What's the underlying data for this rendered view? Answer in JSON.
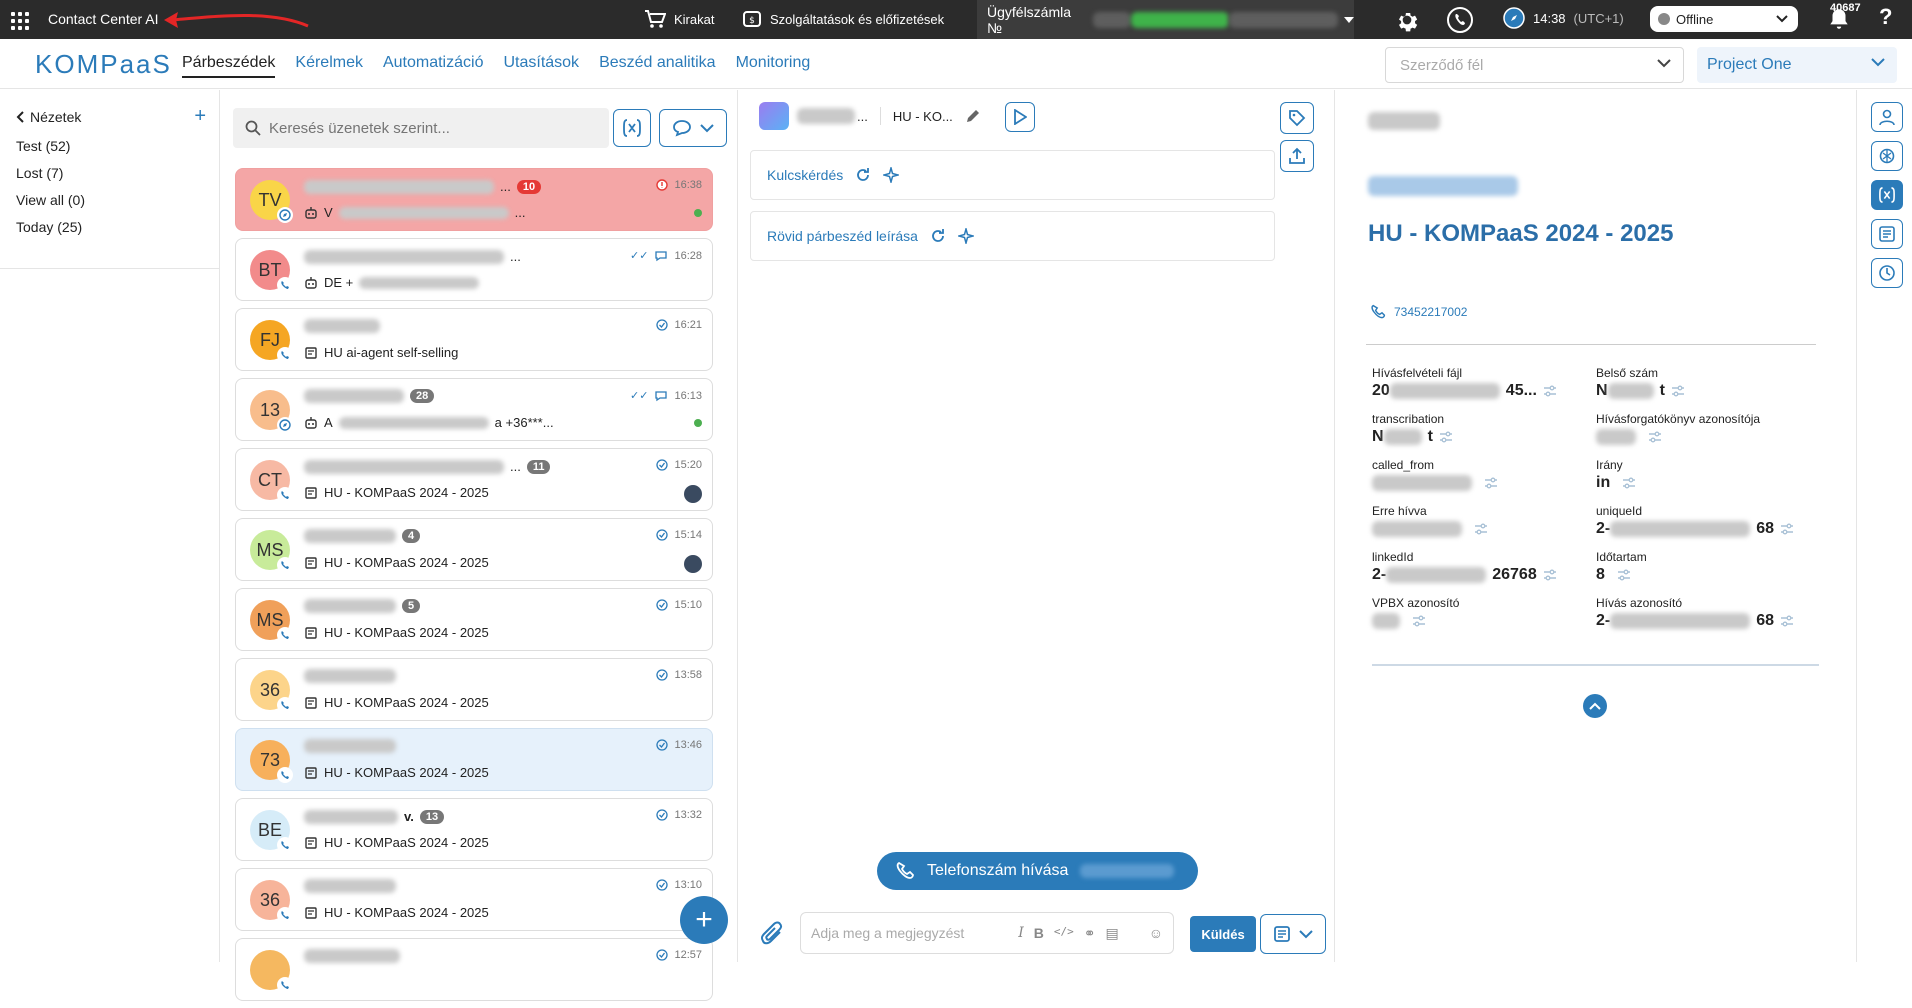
{
  "topbar": {
    "app_title": "Contact Center AI",
    "shop_label": "Kirakat",
    "services_label": "Szolgáltatások és előfizetések",
    "account_label": "Ügyfélszámla №",
    "time": "14:38",
    "timezone": "(UTC+1)",
    "status": "Offline",
    "notification_count": "40687",
    "help": "?"
  },
  "navbar": {
    "logo": "KOMPaaS",
    "tabs": [
      "Párbeszédek",
      "Kérelmek",
      "Automatizáció",
      "Utasítások",
      "Beszéd analitika",
      "Monitoring"
    ],
    "party_placeholder": "Szerződő fél",
    "project": "Project One"
  },
  "views": {
    "header": "Nézetek",
    "add": "+",
    "items": [
      "Test (52)",
      "Lost (7)",
      "View all (0)",
      "Today (25)"
    ]
  },
  "search": {
    "placeholder": "Keresés üzenetek szerint..."
  },
  "conversations": [
    {
      "initials": "TV",
      "color": "#f9d548",
      "count": "10",
      "time": "16:38",
      "sub": "V",
      "sub_suffix": "...",
      "state": "alert"
    },
    {
      "initials": "BT",
      "color": "#f28b8b",
      "count": "",
      "time": "16:28",
      "sub": "DE +",
      "sub_suffix": "",
      "state": ""
    },
    {
      "initials": "FJ",
      "color": "#f5a623",
      "count": "",
      "time": "16:21",
      "sub": "HU ai-agent self-selling",
      "sub_suffix": "",
      "state": ""
    },
    {
      "initials": "13",
      "color": "#f8bd8c",
      "count": "28",
      "time": "16:13",
      "sub": "A",
      "sub_suffix": "a +36***...",
      "state": ""
    },
    {
      "initials": "CT",
      "color": "#f7b9a4",
      "count": "11",
      "time": "15:20",
      "sub": "HU - KOMPaaS 2024 - 2025",
      "sub_suffix": "",
      "state": ""
    },
    {
      "initials": "MS",
      "color": "#c8eb9a",
      "count": "4",
      "time": "15:14",
      "sub": "HU - KOMPaaS 2024 - 2025",
      "sub_suffix": "",
      "state": ""
    },
    {
      "initials": "MS",
      "color": "#f0a05a",
      "count": "5",
      "time": "15:10",
      "sub": "HU - KOMPaaS 2024 - 2025",
      "sub_suffix": "",
      "state": ""
    },
    {
      "initials": "36",
      "color": "#fcd48a",
      "count": "",
      "time": "13:58",
      "sub": "HU - KOMPaaS 2024 - 2025",
      "sub_suffix": "",
      "state": ""
    },
    {
      "initials": "73",
      "color": "#f7b05c",
      "count": "",
      "time": "13:46",
      "sub": "HU - KOMPaaS 2024 - 2025",
      "sub_suffix": "",
      "state": "selected"
    },
    {
      "initials": "BE",
      "color": "#d6ecf8",
      "count": "13",
      "time": "13:32",
      "sub": "HU - KOMPaaS 2024 - 2025",
      "sub_suffix": "",
      "state": ""
    },
    {
      "initials": "36",
      "color": "#f7b49a",
      "count": "",
      "time": "13:10",
      "sub": "HU - KOMPaaS 2024 - 2025",
      "sub_suffix": "",
      "state": ""
    },
    {
      "initials": "",
      "color": "#f5b860",
      "count": "",
      "time": "12:57",
      "sub": "",
      "sub_suffix": "",
      "state": ""
    }
  ],
  "chat": {
    "title_suffix": "...",
    "label": "HU - KO...",
    "key_question": "Kulcskérdés",
    "short_summary": "Rövid párbeszéd leírása",
    "call_button": "Telefonszám hívása",
    "note_placeholder": "Adja meg a megjegyzést",
    "send": "Küldés"
  },
  "detail": {
    "title": "HU - KOMPaaS 2024 - 2025",
    "phone": "73452217002",
    "fields": [
      {
        "label": "Hívásfelvételi fájl",
        "value": "20",
        "suffix": "45..."
      },
      {
        "label": "Belső szám",
        "value": "N",
        "suffix": "t"
      },
      {
        "label": "transcribation",
        "value": "N",
        "suffix": "t"
      },
      {
        "label": "Hívásforgatókönyv azonosítója",
        "value": "",
        "suffix": ""
      },
      {
        "label": "called_from",
        "value": "",
        "suffix": ""
      },
      {
        "label": "Irány",
        "value": "in",
        "suffix": ""
      },
      {
        "label": "Erre hívva",
        "value": "",
        "suffix": ""
      },
      {
        "label": "uniqueId",
        "value": "2-",
        "suffix": "68"
      },
      {
        "label": "linkedId",
        "value": "2-",
        "suffix": "26768"
      },
      {
        "label": "Időtartam",
        "value": "8",
        "suffix": ""
      },
      {
        "label": "VPBX azonosító",
        "value": "",
        "suffix": ""
      },
      {
        "label": "Hívás azonosító",
        "value": "2-",
        "suffix": "68"
      }
    ]
  },
  "colors": {
    "accent": "#2b7bb9",
    "topbar": "#2b2b2b",
    "alert": "#f4a6a6",
    "selected": "#e6f1fb"
  }
}
